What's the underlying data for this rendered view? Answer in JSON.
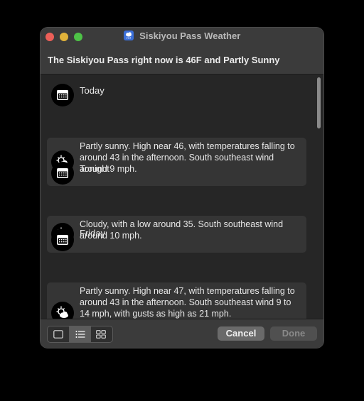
{
  "window": {
    "title": "Siskiyou Pass Weather",
    "app_icon": "cloud-rain-icon",
    "headline": "The Siskiyou Pass right now is 46F and Partly Sunny"
  },
  "forecast": [
    {
      "period": "Today",
      "period_icon": "calendar-icon",
      "description": "Partly sunny. High near 46, with temperatures falling to around 43 in the afternoon. South southeast wind around 9 mph.",
      "description_icon": "partly-sunny-icon"
    },
    {
      "period": "Tonight",
      "period_icon": "calendar-icon",
      "description": "Cloudy, with a low around 35. South southeast wind around 10 mph.",
      "description_icon": "partly-sunny-icon"
    },
    {
      "period": "Friday",
      "period_icon": "calendar-icon",
      "description": "Partly sunny. High near 47, with temperatures falling to around 43 in the afternoon. South southeast wind 9 to 14 mph, with gusts as high as 21 mph.",
      "description_icon": "partly-sunny-icon"
    }
  ],
  "view_modes": [
    {
      "name": "single-view",
      "icon": "square-icon",
      "selected": false
    },
    {
      "name": "list-view",
      "icon": "list-icon",
      "selected": true
    },
    {
      "name": "grid-view",
      "icon": "grid-icon",
      "selected": false
    }
  ],
  "buttons": {
    "cancel": "Cancel",
    "done": "Done",
    "done_enabled": false
  },
  "colors": {
    "close": "#ec5f58",
    "minimize": "#e0b23a",
    "maximize": "#4ec247",
    "window_bg": "#262626",
    "card_bg": "#353535"
  }
}
